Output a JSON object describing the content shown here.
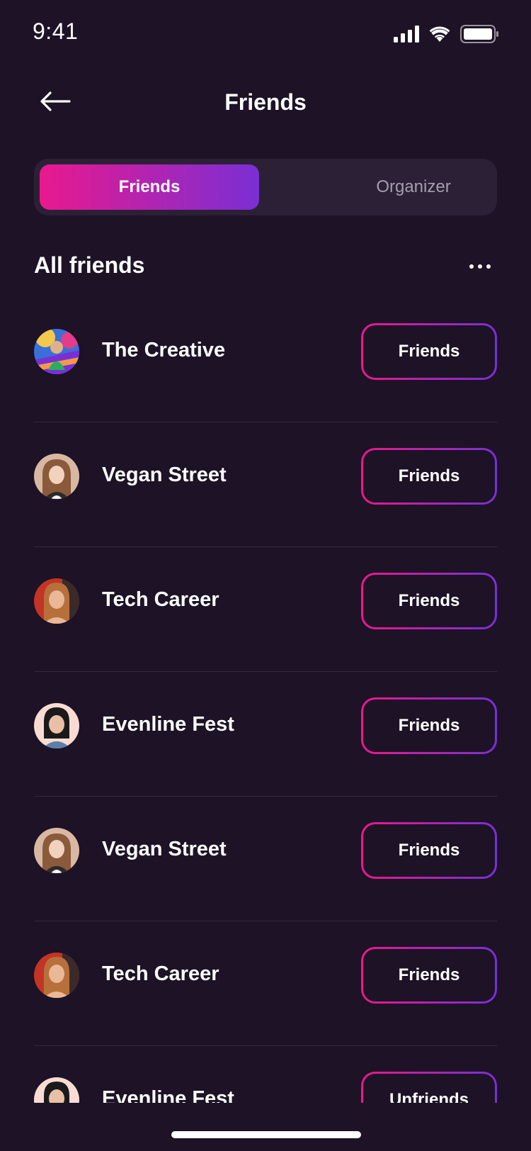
{
  "status_bar": {
    "time": "9:41",
    "signal_icon": "cellular-signal-icon",
    "wifi_icon": "wifi-icon",
    "battery_icon": "battery-icon"
  },
  "header": {
    "title": "Friends",
    "back_icon": "arrow-left-icon"
  },
  "segmented": {
    "tabs": [
      {
        "label": "Friends",
        "active": true
      },
      {
        "label": "Organizer",
        "active": false
      }
    ]
  },
  "section": {
    "title": "All friends",
    "more_icon": "more-horizontal-icon"
  },
  "friends": [
    {
      "name": "The Creative",
      "button": "Friends",
      "avatar": "colorful"
    },
    {
      "name": "Vegan Street",
      "button": "Friends",
      "avatar": "blonde"
    },
    {
      "name": "Tech Career",
      "button": "Friends",
      "avatar": "redhead"
    },
    {
      "name": "Evenline Fest",
      "button": "Friends",
      "avatar": "darkhair"
    },
    {
      "name": "Vegan Street",
      "button": "Friends",
      "avatar": "blonde"
    },
    {
      "name": "Tech Career",
      "button": "Friends",
      "avatar": "redhead"
    },
    {
      "name": "Evenline Fest",
      "button": "Unfriends",
      "avatar": "darkhair"
    }
  ],
  "colors": {
    "background": "#1D1226",
    "surface": "#2B2036",
    "gradient_start": "#E9198E",
    "gradient_end": "#7A2FD4",
    "muted_text": "#A59EB0",
    "divider": "#34293F"
  }
}
